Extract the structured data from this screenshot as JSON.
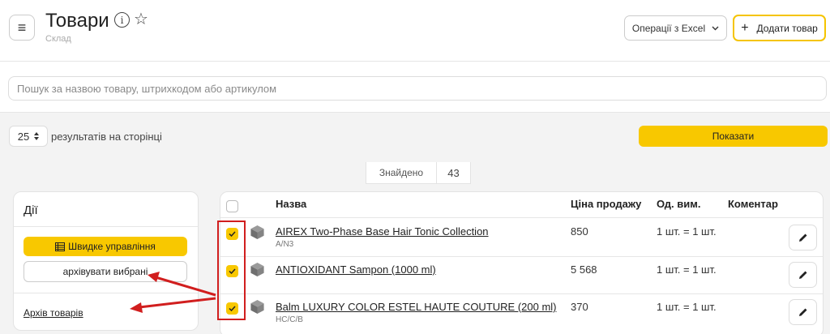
{
  "header": {
    "title": "Товари",
    "subtitle": "Склад",
    "excel_label": "Операції з Excel",
    "add_label": "Додати товар"
  },
  "search": {
    "placeholder": "Пошук за назвою товару, штрихкодом або артикулом",
    "value": ""
  },
  "pagination": {
    "per_page": "25",
    "per_page_label": "результатів на сторінці",
    "show_label": "Показати"
  },
  "found": {
    "label": "Знайдено",
    "count": "43"
  },
  "actions": {
    "title": "Дії",
    "quick_manage_label": "Швидке управління",
    "archive_selected_label": "архівувати вибрані",
    "archive_link_label": "Архів товарів"
  },
  "table": {
    "columns": {
      "name": "Назва",
      "price": "Ціна продажу",
      "unit": "Од. вим.",
      "comment": "Коментар"
    },
    "rows": [
      {
        "name": "AIREX Two-Phase Base Hair Tonic Collection",
        "code": "A/N3",
        "price": "850",
        "unit": "1 шт. = 1 шт.",
        "checked": true
      },
      {
        "name": "ANTIOXIDANT Sampon (1000 ml)",
        "code": "",
        "price": "5 568",
        "unit": "1 шт. = 1 шт.",
        "checked": true
      },
      {
        "name": "Balm LUXURY COLOR ESTEL HAUTE COUTURE (200 ml)",
        "code": "HC/C/B",
        "price": "370",
        "unit": "1 шт. = 1 шт.",
        "checked": true
      }
    ]
  },
  "colors": {
    "accent": "#f8c800",
    "annotation": "#d11e1e"
  },
  "icons": [
    "hamburger-icon",
    "info-icon",
    "star-icon",
    "chevron-down-icon",
    "plus-icon",
    "list-icon",
    "box-icon",
    "pencil-icon",
    "checkmark-icon"
  ]
}
